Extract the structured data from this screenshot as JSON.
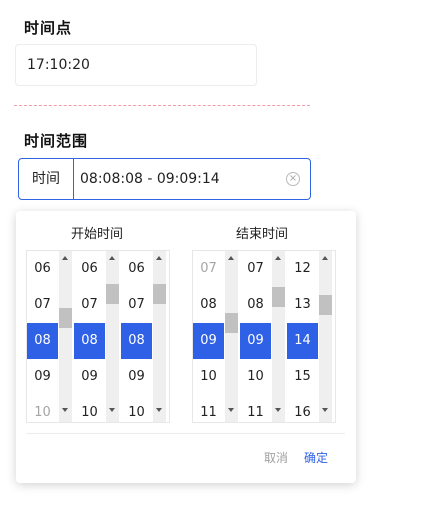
{
  "time_point": {
    "label": "时间点",
    "value": "17:10:20"
  },
  "time_range": {
    "label": "时间范围",
    "prefix": "时间",
    "value": "08:08:08 - 09:09:14",
    "clear_icon": "×"
  },
  "picker": {
    "start": {
      "title": "开始时间",
      "columns": [
        {
          "items": [
            "06",
            "07",
            "08",
            "09",
            "10"
          ],
          "selected": "08"
        },
        {
          "items": [
            "06",
            "07",
            "08",
            "09",
            "10"
          ],
          "selected": "08"
        },
        {
          "items": [
            "06",
            "07",
            "08",
            "09",
            "10"
          ],
          "selected": "08"
        }
      ]
    },
    "end": {
      "title": "结束时间",
      "columns": [
        {
          "items": [
            "07",
            "08",
            "09",
            "10",
            "11"
          ],
          "selected": "09"
        },
        {
          "items": [
            "07",
            "08",
            "09",
            "10",
            "11"
          ],
          "selected": "09"
        },
        {
          "items": [
            "12",
            "13",
            "14",
            "15",
            "16"
          ],
          "selected": "14"
        }
      ]
    },
    "cancel_label": "取消",
    "ok_label": "确定"
  },
  "colors": {
    "accent": "#2f61e6",
    "divider": "#f29aa6",
    "disabled_text": "#a5a5a5"
  },
  "icons": {
    "clear": "clear-circle-icon",
    "scroll_up": "triangle-up-icon",
    "scroll_down": "triangle-down-icon"
  }
}
